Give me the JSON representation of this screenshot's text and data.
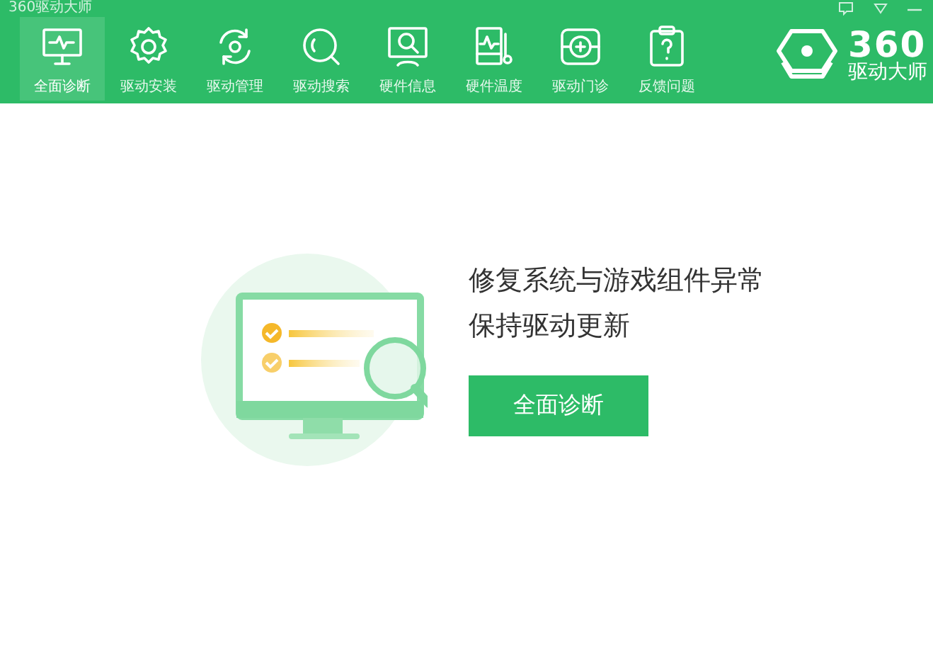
{
  "window": {
    "title": "360驱动大师"
  },
  "nav": [
    {
      "label": "全面诊断",
      "selected": true
    },
    {
      "label": "驱动安装",
      "selected": false
    },
    {
      "label": "驱动管理",
      "selected": false
    },
    {
      "label": "驱动搜索",
      "selected": false
    },
    {
      "label": "硬件信息",
      "selected": false
    },
    {
      "label": "硬件温度",
      "selected": false
    },
    {
      "label": "驱动门诊",
      "selected": false
    },
    {
      "label": "反馈问题",
      "selected": false
    }
  ],
  "logo": {
    "number": "360",
    "name": "驱动大师"
  },
  "main": {
    "lines": [
      "修复系统与游戏组件异常",
      "保持驱动更新"
    ],
    "button": "全面诊断"
  }
}
